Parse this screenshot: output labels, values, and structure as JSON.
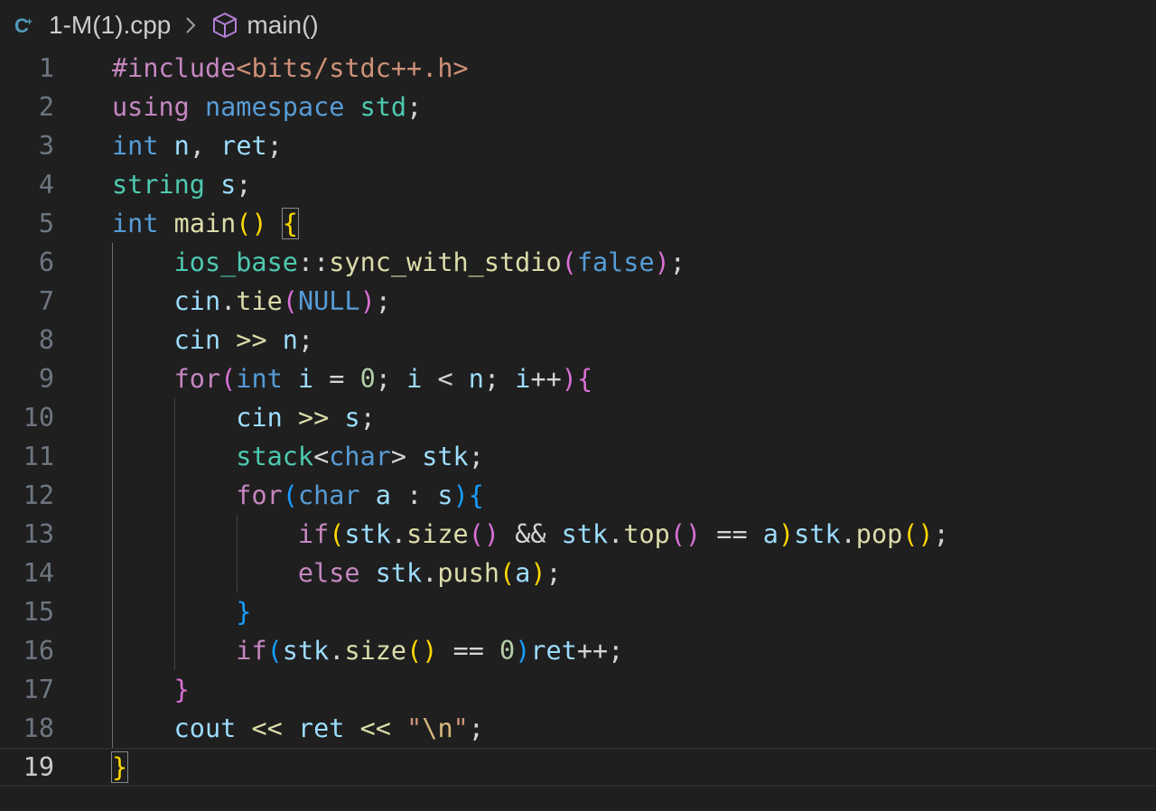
{
  "breadcrumb": {
    "file_name": "1-M(1).cpp",
    "symbol_name": "main()",
    "file_icon": "cpp-file-icon",
    "separator_icon": "chevron-right-icon",
    "symbol_icon": "method-cube-icon"
  },
  "editor": {
    "language": "cpp",
    "current_line": 19,
    "colors": {
      "background": "#1f1f1f",
      "line_number": "#6e7681",
      "line_number_active": "#cccccc",
      "keyword_control": "#c586c0",
      "keyword_storage": "#569cd6",
      "type": "#4ec9b0",
      "variable": "#9cdcfe",
      "function": "#dcdcaa",
      "number": "#b5cea8",
      "string": "#ce9178",
      "bracket_level1": "#ffd700",
      "bracket_level2": "#da70d6",
      "bracket_level3": "#179fff"
    },
    "lines": [
      {
        "number": "1",
        "tokens": [
          [
            "t-pre",
            "#include"
          ],
          [
            "t-inc",
            "<bits/stdc++.h>"
          ]
        ]
      },
      {
        "number": "2",
        "tokens": [
          [
            "t-kw",
            "using"
          ],
          [
            "t-op",
            " "
          ],
          [
            "t-kw2",
            "namespace"
          ],
          [
            "t-op",
            " "
          ],
          [
            "t-type",
            "std"
          ],
          [
            "t-op",
            ";"
          ]
        ]
      },
      {
        "number": "3",
        "tokens": [
          [
            "t-kw2",
            "int"
          ],
          [
            "t-op",
            " "
          ],
          [
            "t-var",
            "n"
          ],
          [
            "t-op",
            ", "
          ],
          [
            "t-var",
            "ret"
          ],
          [
            "t-op",
            ";"
          ]
        ]
      },
      {
        "number": "4",
        "tokens": [
          [
            "t-type",
            "string"
          ],
          [
            "t-op",
            " "
          ],
          [
            "t-var",
            "s"
          ],
          [
            "t-op",
            ";"
          ]
        ]
      },
      {
        "number": "5",
        "tokens": [
          [
            "t-kw2",
            "int"
          ],
          [
            "t-op",
            " "
          ],
          [
            "t-fn",
            "main"
          ],
          [
            "t-b1",
            "()"
          ],
          [
            "t-op",
            " "
          ],
          [
            "t-b1-match",
            "{"
          ]
        ]
      },
      {
        "number": "6",
        "tokens": [
          [
            "t-op",
            "    "
          ],
          [
            "t-type",
            "ios_base"
          ],
          [
            "t-op",
            "::"
          ],
          [
            "t-fn",
            "sync_with_stdio"
          ],
          [
            "t-b2",
            "("
          ],
          [
            "t-kw2",
            "false"
          ],
          [
            "t-b2",
            ")"
          ],
          [
            "t-op",
            ";"
          ]
        ]
      },
      {
        "number": "7",
        "tokens": [
          [
            "t-op",
            "    "
          ],
          [
            "t-var",
            "cin"
          ],
          [
            "t-op",
            "."
          ],
          [
            "t-fn",
            "tie"
          ],
          [
            "t-b2",
            "("
          ],
          [
            "t-kw2",
            "NULL"
          ],
          [
            "t-b2",
            ")"
          ],
          [
            "t-op",
            ";"
          ]
        ]
      },
      {
        "number": "8",
        "tokens": [
          [
            "t-op",
            "    "
          ],
          [
            "t-var",
            "cin"
          ],
          [
            "t-op",
            " "
          ],
          [
            "t-fn",
            ">>"
          ],
          [
            "t-op",
            " "
          ],
          [
            "t-var",
            "n"
          ],
          [
            "t-op",
            ";"
          ]
        ]
      },
      {
        "number": "9",
        "tokens": [
          [
            "t-op",
            "    "
          ],
          [
            "t-kw",
            "for"
          ],
          [
            "t-b2",
            "("
          ],
          [
            "t-kw2",
            "int"
          ],
          [
            "t-op",
            " "
          ],
          [
            "t-var",
            "i"
          ],
          [
            "t-op",
            " = "
          ],
          [
            "t-num",
            "0"
          ],
          [
            "t-op",
            "; "
          ],
          [
            "t-var",
            "i"
          ],
          [
            "t-op",
            " < "
          ],
          [
            "t-var",
            "n"
          ],
          [
            "t-op",
            "; "
          ],
          [
            "t-var",
            "i"
          ],
          [
            "t-op",
            "++"
          ],
          [
            "t-b2",
            ")"
          ],
          [
            "t-b2",
            "{"
          ]
        ]
      },
      {
        "number": "10",
        "tokens": [
          [
            "t-op",
            "        "
          ],
          [
            "t-var",
            "cin"
          ],
          [
            "t-op",
            " "
          ],
          [
            "t-fn",
            ">>"
          ],
          [
            "t-op",
            " "
          ],
          [
            "t-var",
            "s"
          ],
          [
            "t-op",
            ";"
          ]
        ]
      },
      {
        "number": "11",
        "tokens": [
          [
            "t-op",
            "        "
          ],
          [
            "t-type",
            "stack"
          ],
          [
            "t-op",
            "<"
          ],
          [
            "t-kw2",
            "char"
          ],
          [
            "t-op",
            "> "
          ],
          [
            "t-var",
            "stk"
          ],
          [
            "t-op",
            ";"
          ]
        ]
      },
      {
        "number": "12",
        "tokens": [
          [
            "t-op",
            "        "
          ],
          [
            "t-kw",
            "for"
          ],
          [
            "t-b3",
            "("
          ],
          [
            "t-kw2",
            "char"
          ],
          [
            "t-op",
            " "
          ],
          [
            "t-var",
            "a"
          ],
          [
            "t-op",
            " : "
          ],
          [
            "t-var",
            "s"
          ],
          [
            "t-b3",
            ")"
          ],
          [
            "t-b3",
            "{"
          ]
        ]
      },
      {
        "number": "13",
        "tokens": [
          [
            "t-op",
            "            "
          ],
          [
            "t-kw",
            "if"
          ],
          [
            "t-b1",
            "("
          ],
          [
            "t-var",
            "stk"
          ],
          [
            "t-op",
            "."
          ],
          [
            "t-fn",
            "size"
          ],
          [
            "t-b2",
            "()"
          ],
          [
            "t-op",
            " && "
          ],
          [
            "t-var",
            "stk"
          ],
          [
            "t-op",
            "."
          ],
          [
            "t-fn",
            "top"
          ],
          [
            "t-b2",
            "()"
          ],
          [
            "t-op",
            " == "
          ],
          [
            "t-var",
            "a"
          ],
          [
            "t-b1",
            ")"
          ],
          [
            "t-var",
            "stk"
          ],
          [
            "t-op",
            "."
          ],
          [
            "t-fn",
            "pop"
          ],
          [
            "t-b1",
            "()"
          ],
          [
            "t-op",
            ";"
          ]
        ]
      },
      {
        "number": "14",
        "tokens": [
          [
            "t-op",
            "            "
          ],
          [
            "t-kw",
            "else"
          ],
          [
            "t-op",
            " "
          ],
          [
            "t-var",
            "stk"
          ],
          [
            "t-op",
            "."
          ],
          [
            "t-fn",
            "push"
          ],
          [
            "t-b1",
            "("
          ],
          [
            "t-var",
            "a"
          ],
          [
            "t-b1",
            ")"
          ],
          [
            "t-op",
            ";"
          ]
        ]
      },
      {
        "number": "15",
        "tokens": [
          [
            "t-op",
            "        "
          ],
          [
            "t-b3",
            "}"
          ]
        ]
      },
      {
        "number": "16",
        "tokens": [
          [
            "t-op",
            "        "
          ],
          [
            "t-kw",
            "if"
          ],
          [
            "t-b3",
            "("
          ],
          [
            "t-var",
            "stk"
          ],
          [
            "t-op",
            "."
          ],
          [
            "t-fn",
            "size"
          ],
          [
            "t-b1",
            "()"
          ],
          [
            "t-op",
            " == "
          ],
          [
            "t-num",
            "0"
          ],
          [
            "t-b3",
            ")"
          ],
          [
            "t-var",
            "ret"
          ],
          [
            "t-op",
            "++;"
          ]
        ]
      },
      {
        "number": "17",
        "tokens": [
          [
            "t-op",
            "    "
          ],
          [
            "t-b2",
            "}"
          ]
        ]
      },
      {
        "number": "18",
        "tokens": [
          [
            "t-op",
            "    "
          ],
          [
            "t-var",
            "cout"
          ],
          [
            "t-op",
            " "
          ],
          [
            "t-fn",
            "<<"
          ],
          [
            "t-op",
            " "
          ],
          [
            "t-var",
            "ret"
          ],
          [
            "t-op",
            " "
          ],
          [
            "t-fn",
            "<<"
          ],
          [
            "t-op",
            " "
          ],
          [
            "t-str",
            "\""
          ],
          [
            "t-esc",
            "\\n"
          ],
          [
            "t-str",
            "\""
          ],
          [
            "t-op",
            ";"
          ]
        ]
      },
      {
        "number": "19",
        "tokens": [
          [
            "t-b1-match",
            "}"
          ]
        ]
      }
    ]
  }
}
